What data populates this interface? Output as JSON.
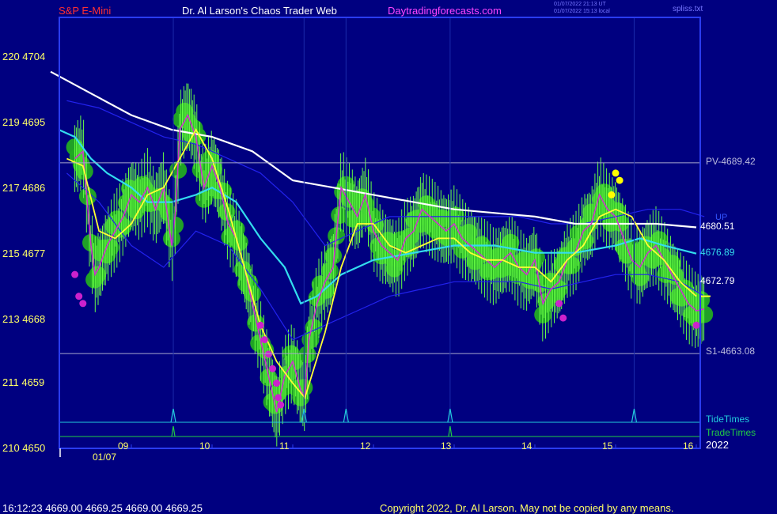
{
  "header": {
    "symbol": "S&P E-Mini",
    "site_title": "Dr. Al Larson's Chaos Trader Web",
    "website": "Daytradingforecasts.com",
    "timestamp_ut": "01/07/2022 21:13 UT",
    "timestamp_local": "01/07/2022 15:13 local",
    "filename": "spliss.txt"
  },
  "footer": {
    "quote": "16:12:23  4669.00 4669.25 4669.00 4669.25",
    "copyright": "Copyright 2022, Dr. Al Larson. May not be copied by any means."
  },
  "colors": {
    "background": "#000080",
    "frame": "#2a3cf0",
    "price_text": "#ffff66",
    "title_red": "#ff3030",
    "website_magenta": "#ff44ff",
    "tide": "#22ccdd",
    "trade": "#22cc44",
    "ema_white": "#ffffff",
    "ema_cyan": "#33ddee",
    "band_blue": "#2222ee",
    "fast_yellow": "#ffff33",
    "price_magenta": "#cc33cc",
    "bubble_green": "#22aa22",
    "price_bar_green": "#66ff44"
  },
  "chart_data": {
    "type": "line",
    "title": "S&P E-Mini",
    "xlabel": "",
    "ylabel": "",
    "x_ticks": [
      "09",
      "10",
      "11",
      "12",
      "13",
      "14",
      "15",
      "16"
    ],
    "x_tick_values": [
      9,
      10,
      11,
      12,
      13,
      14,
      15,
      16
    ],
    "date_label": "01/07",
    "year_label": "2022",
    "xlim": [
      8.0,
      16.1
    ],
    "ylim": [
      4650,
      4710
    ],
    "y_ticks": [
      {
        "value": 4704,
        "label": "220  4704"
      },
      {
        "value": 4695,
        "label": "219  4695"
      },
      {
        "value": 4686,
        "label": "217  4686"
      },
      {
        "value": 4677,
        "label": "215  4677"
      },
      {
        "value": 4668,
        "label": "213  4668"
      },
      {
        "value": 4659,
        "label": "211  4659"
      },
      {
        "value": 4650,
        "label": "210  4650"
      }
    ],
    "levels": [
      {
        "name": "PV",
        "value": 4689.42,
        "label": "PV-4689.42"
      },
      {
        "name": "S1",
        "value": 4663.08,
        "label": "S1-4663.08"
      }
    ],
    "level_tag": "UP",
    "right_labels": [
      {
        "value": 4680.51,
        "label": "4680.51",
        "color": "#ffffff"
      },
      {
        "value": 4676.89,
        "label": "4676.89",
        "color": "#33ddee"
      },
      {
        "value": 4672.79,
        "label": "4672.79",
        "color": "#ffffff"
      }
    ],
    "tide_label": "TideTimes",
    "trade_label": "TradeTimes",
    "tide_times": [
      9.52,
      11.14,
      11.66,
      12.95,
      15.23
    ],
    "trade_times": [
      9.52,
      12.95
    ],
    "series": [
      {
        "name": "price",
        "color": "#cc33cc",
        "x": [
          8.3,
          8.4,
          8.5,
          8.55,
          8.6,
          8.7,
          8.8,
          8.9,
          9.0,
          9.1,
          9.2,
          9.3,
          9.4,
          9.5,
          9.55,
          9.6,
          9.7,
          9.8,
          9.9,
          10.0,
          10.1,
          10.2,
          10.3,
          10.4,
          10.5,
          10.6,
          10.7,
          10.8,
          10.9,
          11.0,
          11.1,
          11.15,
          11.2,
          11.3,
          11.4,
          11.5,
          11.6,
          11.7,
          11.8,
          11.9,
          12.0,
          12.1,
          12.2,
          12.3,
          12.4,
          12.5,
          12.6,
          12.7,
          12.8,
          12.9,
          13.0,
          13.1,
          13.2,
          13.3,
          13.4,
          13.5,
          13.6,
          13.7,
          13.8,
          13.9,
          14.0,
          14.1,
          14.2,
          14.3,
          14.4,
          14.5,
          14.6,
          14.7,
          14.8,
          14.9,
          15.0,
          15.1,
          15.2,
          15.3,
          15.4,
          15.5,
          15.6,
          15.7,
          15.8,
          15.9,
          16.0,
          16.1
        ],
        "y": [
          4690,
          4691,
          4678,
          4674,
          4675,
          4678,
          4680,
          4682,
          4685,
          4684,
          4686,
          4683,
          4686,
          4678,
          4683,
          4694,
          4696,
          4693,
          4686,
          4689,
          4686,
          4681,
          4679,
          4675,
          4670,
          4665,
          4660,
          4655,
          4660,
          4662,
          4658,
          4657,
          4665,
          4670,
          4673,
          4675,
          4686,
          4684,
          4682,
          4685,
          4680,
          4678,
          4677,
          4676,
          4679,
          4680,
          4683,
          4682,
          4681,
          4680,
          4681,
          4679,
          4678,
          4677,
          4676,
          4675,
          4676,
          4677,
          4675,
          4674,
          4676,
          4670,
          4672,
          4673,
          4676,
          4677,
          4680,
          4681,
          4685,
          4683,
          4682,
          4679,
          4676,
          4675,
          4677,
          4678,
          4676,
          4674,
          4672,
          4670,
          4669,
          4669.25
        ]
      },
      {
        "name": "fast",
        "color": "#ffff33",
        "x": [
          8.2,
          8.4,
          8.6,
          8.8,
          9.0,
          9.2,
          9.4,
          9.6,
          9.8,
          10.0,
          10.2,
          10.4,
          10.6,
          10.8,
          11.0,
          11.15,
          11.4,
          11.6,
          11.8,
          12.0,
          12.2,
          12.4,
          12.6,
          12.8,
          13.0,
          13.2,
          13.4,
          13.6,
          13.8,
          14.0,
          14.2,
          14.4,
          14.6,
          14.8,
          15.0,
          15.2,
          15.4,
          15.6,
          15.8,
          16.0
        ],
        "y": [
          4690,
          4689,
          4680,
          4679,
          4681,
          4685,
          4686,
          4690,
          4694,
          4690,
          4683,
          4675,
          4667,
          4662,
          4659,
          4657,
          4666,
          4675,
          4681,
          4681,
          4678,
          4677,
          4678,
          4679,
          4679,
          4677,
          4676,
          4676,
          4675,
          4675,
          4673,
          4676,
          4678,
          4682,
          4683,
          4682,
          4678,
          4676,
          4673,
          4671
        ]
      },
      {
        "name": "ema_cyan",
        "color": "#33ddee",
        "x": [
          8.1,
          8.3,
          8.5,
          8.7,
          9.0,
          9.2,
          9.5,
          9.8,
          10.0,
          10.3,
          10.6,
          10.9,
          11.1,
          11.3,
          11.6,
          12.0,
          12.5,
          13.0,
          13.5,
          14.0,
          14.5,
          15.0,
          15.3,
          15.6,
          16.0
        ],
        "y": [
          4694,
          4693,
          4690,
          4688,
          4686,
          4684,
          4684,
          4685,
          4686,
          4684,
          4679,
          4675,
          4670,
          4671,
          4674,
          4676,
          4677,
          4678,
          4678,
          4677,
          4677,
          4678,
          4679,
          4678,
          4676.89
        ]
      },
      {
        "name": "ema_white",
        "color": "#ffffff",
        "x": [
          8.0,
          8.5,
          9.0,
          9.5,
          10.0,
          10.5,
          11.0,
          11.5,
          12.0,
          12.5,
          13.0,
          13.5,
          14.0,
          14.5,
          15.0,
          15.5,
          16.0
        ],
        "y": [
          4702,
          4699,
          4696,
          4694,
          4693,
          4691,
          4687,
          4686,
          4685,
          4684,
          4683,
          4682.5,
          4682,
          4681,
          4681,
          4681,
          4680.51
        ]
      },
      {
        "name": "band_upper",
        "color": "#2222ee",
        "x": [
          8.2,
          8.6,
          9.0,
          9.4,
          9.8,
          10.2,
          10.6,
          11.0,
          11.4,
          11.8,
          12.2,
          12.6,
          13.0,
          13.4,
          13.8,
          14.2,
          14.6,
          15.0,
          15.4,
          15.8,
          16.1
        ],
        "y": [
          4698,
          4697,
          4695,
          4693,
          4692,
          4690,
          4688,
          4684,
          4678,
          4680,
          4682,
          4682,
          4682,
          4682,
          4682,
          4681,
          4681,
          4682,
          4683,
          4683,
          4682
        ]
      },
      {
        "name": "band_lower",
        "color": "#2222ee",
        "x": [
          8.2,
          8.6,
          9.0,
          9.4,
          9.8,
          10.2,
          10.6,
          11.0,
          11.4,
          11.8,
          12.2,
          12.6,
          13.0,
          13.4,
          13.8,
          14.2,
          14.6,
          15.0,
          15.4,
          15.8,
          16.1
        ],
        "y": [
          4688,
          4684,
          4678,
          4675,
          4680,
          4678,
          4672,
          4665,
          4667,
          4669,
          4671,
          4672,
          4673,
          4673,
          4673,
          4672,
          4673,
          4674,
          4674,
          4673,
          4671
        ]
      }
    ],
    "markers": {
      "magenta": [
        [
          8.3,
          4674
        ],
        [
          8.35,
          4671
        ],
        [
          8.4,
          4670
        ],
        [
          10.6,
          4667
        ],
        [
          10.65,
          4665
        ],
        [
          10.7,
          4663
        ],
        [
          10.75,
          4661
        ],
        [
          10.8,
          4659
        ],
        [
          10.82,
          4657
        ],
        [
          10.85,
          4656
        ],
        [
          14.3,
          4670
        ],
        [
          14.35,
          4668
        ],
        [
          16.0,
          4667
        ]
      ],
      "yellow": [
        [
          15.0,
          4688
        ],
        [
          15.05,
          4687
        ],
        [
          14.95,
          4685
        ]
      ]
    },
    "grid": false,
    "legend": "none"
  }
}
